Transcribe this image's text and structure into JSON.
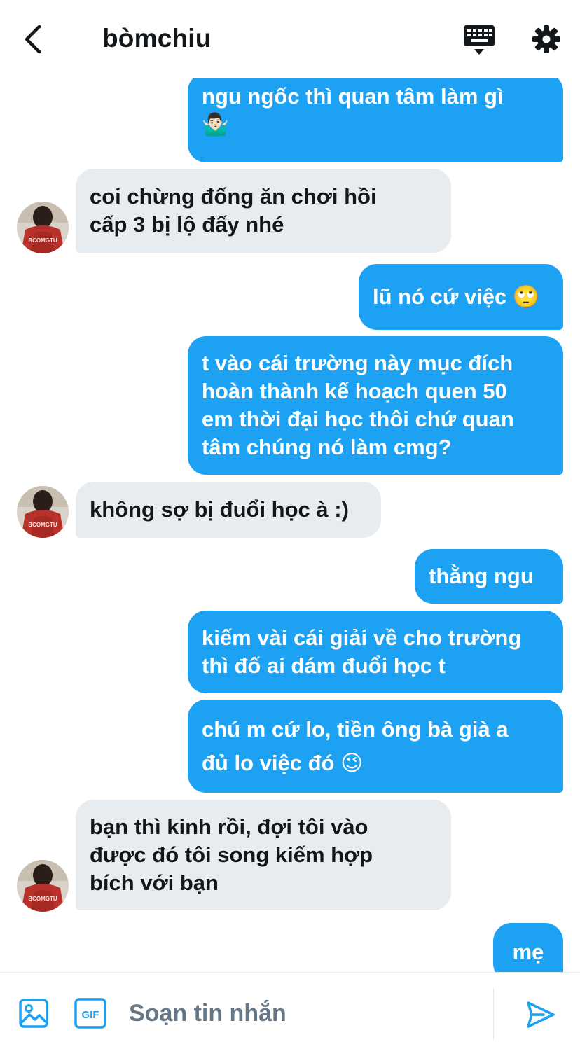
{
  "header": {
    "title": "bòmchiu",
    "back_icon": "chevron-left-icon",
    "keyboard_icon": "keyboard-icon",
    "settings_icon": "gear-icon"
  },
  "colors": {
    "accent": "#1da1f2",
    "incoming_bubble": "#e6ecf0",
    "text_dark": "#14171a",
    "placeholder": "#657786"
  },
  "messages": [
    {
      "from": "me",
      "text": "ngu ngốc thì quan tâm làm gì\n🤷🏻‍♂️"
    },
    {
      "from": "them",
      "text": "coi chừng đống ăn chơi hồi\ncấp 3 bị lộ đấy nhé"
    },
    {
      "from": "me",
      "text": "lũ nó cứ việc 🙄"
    },
    {
      "from": "me",
      "text": "t vào cái trường này mục đích\nhoàn thành kế hoạch quen 50\nem thời đại học thôi chứ quan\ntâm chúng nó làm cmg?"
    },
    {
      "from": "them",
      "text": "không sợ bị đuổi học à :)"
    },
    {
      "from": "me",
      "text": "thằng ngu"
    },
    {
      "from": "me",
      "text": "kiếm vài cái giải về cho trường\nthì đố ai dám đuổi học t"
    },
    {
      "from": "me",
      "text": "chú m cứ lo, tiền ông bà già a\nđủ lo việc đó 😉"
    },
    {
      "from": "them",
      "text": "bạn thì kinh rồi, đợi tôi vào\nđược đó tôi song kiếm hợp\nbích với bạn"
    },
    {
      "from": "me",
      "text": "mẹ"
    }
  ],
  "composer": {
    "placeholder": "Soạn tin nhắn",
    "media_icon": "image-icon",
    "gif_icon": "gif-icon",
    "send_icon": "send-icon"
  }
}
